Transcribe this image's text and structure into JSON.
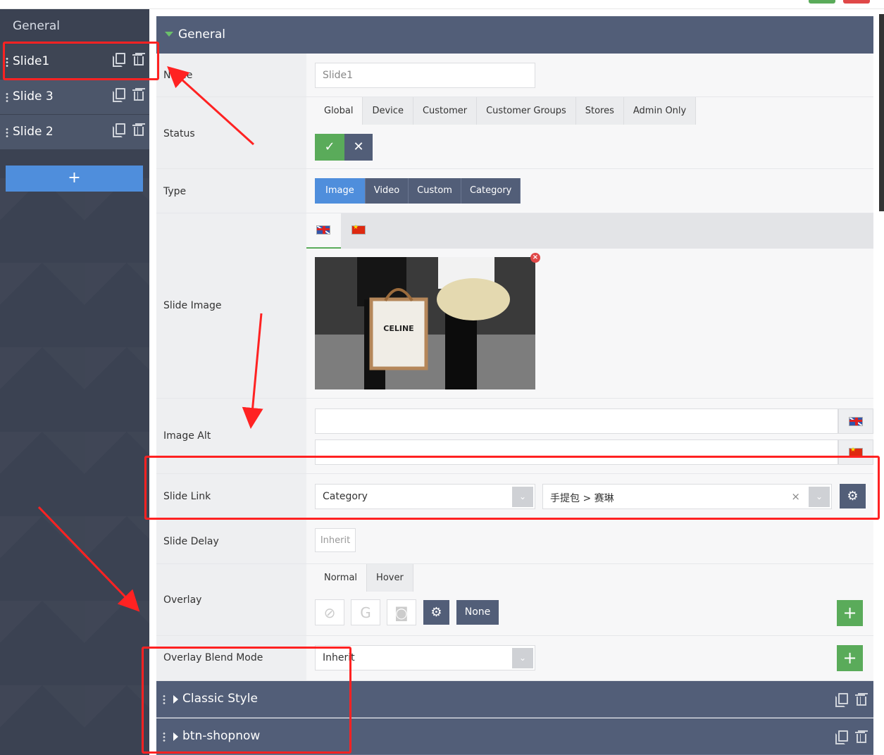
{
  "sidebar": {
    "general_label": "General",
    "slides": [
      {
        "label": "Slide1"
      },
      {
        "label": "Slide 3"
      },
      {
        "label": "Slide 2"
      }
    ],
    "add_label": "+"
  },
  "panel": {
    "title": "General",
    "name": {
      "label": "Name",
      "value": "Slide1"
    },
    "status": {
      "label": "Status",
      "tabs": [
        "Global",
        "Device",
        "Customer",
        "Customer Groups",
        "Stores",
        "Admin Only"
      ],
      "on_icon": "✓",
      "off_icon": "✕"
    },
    "type": {
      "label": "Type",
      "options": [
        "Image",
        "Video",
        "Custom",
        "Category"
      ],
      "selected": "Image"
    },
    "slide_image": {
      "label": "Slide Image",
      "image_text": "CELINE",
      "remove_icon": "×"
    },
    "image_alt": {
      "label": "Image Alt"
    },
    "slide_link": {
      "label": "Slide Link",
      "type_value": "Category",
      "path_value": "手提包  >  赛琳",
      "clear": "×"
    },
    "slide_delay": {
      "label": "Slide Delay",
      "placeholder": "Inherit"
    },
    "overlay": {
      "label": "Overlay",
      "tabs": [
        "Normal",
        "Hover"
      ],
      "none_label": "None",
      "g_label": "G"
    },
    "overlay_blend": {
      "label": "Overlay Blend Mode",
      "value": "Inherit"
    },
    "sections": [
      {
        "title": "Classic Style"
      },
      {
        "title": "btn-shopnow"
      }
    ],
    "plus_label": "+"
  },
  "colors": {
    "header": "#525e78",
    "accent_blue": "#4f8edc",
    "green": "#5aab5a",
    "annotation_red": "#ff2222"
  }
}
